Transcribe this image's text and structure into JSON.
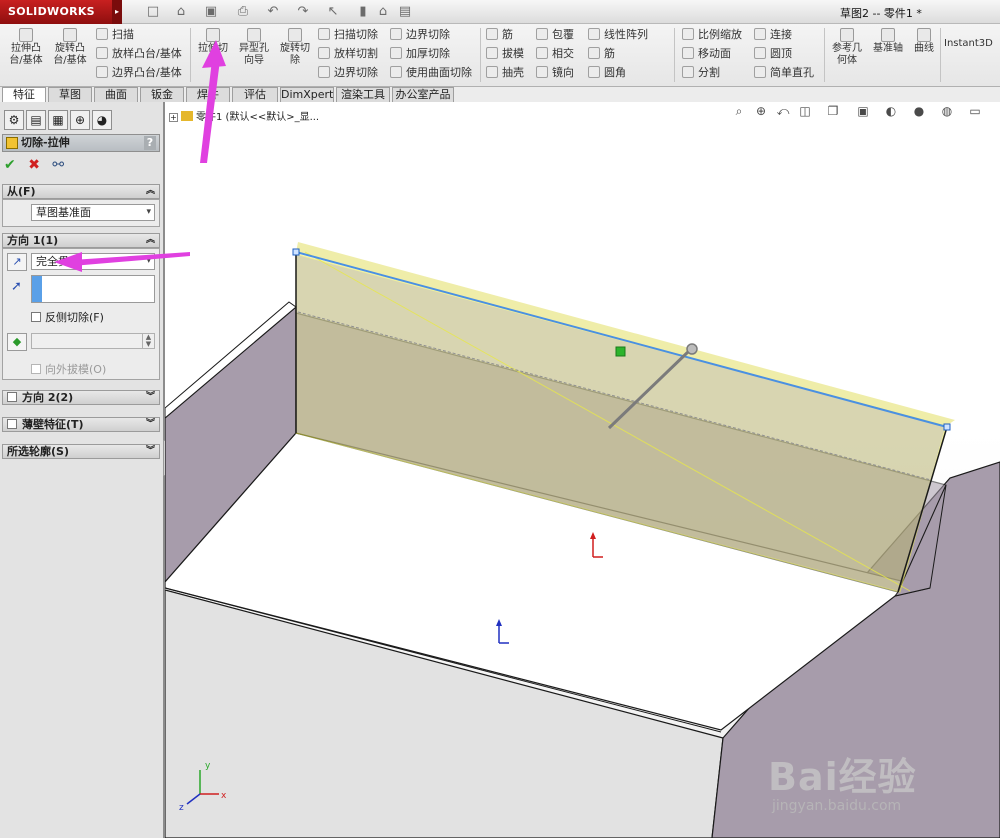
{
  "app": {
    "brand": "SOLIDWORKS",
    "document_title": "草图2 -- 零件1 *"
  },
  "quick_access": [
    "new-icon",
    "open-icon",
    "save-icon",
    "print-icon",
    "undo-icon",
    "redo-icon",
    "select-icon",
    "rebuild-icon",
    "options-icon"
  ],
  "toolbar": {
    "extrude_boss": "拉伸凸\n台/基体",
    "revolve_boss": "旋转凸\n台/基体",
    "sweep": "扫描",
    "loft_boss": "放样凸台/基体",
    "boundary_boss": "边界凸台/基体",
    "extrude_cut": "拉伸切\n除",
    "hole_wizard": "异型孔\n向导",
    "revolve_cut": "旋转切\n除",
    "swept_cut": "扫描切除",
    "lofted_cut": "放样切割",
    "boundary_cut": "边界切除",
    "boundary_cut2": "边界切除",
    "thicken_cut": "加厚切除",
    "surface_cut": "使用曲面切除",
    "rib": "筋",
    "draft": "拔模",
    "shell": "抽壳",
    "wrap": "包覆",
    "intersect": "相交",
    "mirror": "镜向",
    "linear_pattern": "线性阵列",
    "rib2": "筋",
    "fillet": "圆角",
    "scale": "比例缩放",
    "move_face": "移动面",
    "split": "分割",
    "connect": "连接",
    "dome": "圆顶",
    "simple_hole": "简单直孔",
    "ref_geometry": "参考几\n何体",
    "datum_axis": "基准轴",
    "curves": "曲线",
    "instant3d": "Instant3D"
  },
  "tabs": [
    {
      "label": "特征",
      "active": true
    },
    {
      "label": "草图",
      "active": false
    },
    {
      "label": "曲面",
      "active": false
    },
    {
      "label": "钣金",
      "active": false
    },
    {
      "label": "焊件",
      "active": false
    },
    {
      "label": "评估",
      "active": false
    },
    {
      "label": "DimXpert",
      "active": false
    },
    {
      "label": "渲染工具",
      "active": false
    },
    {
      "label": "办公室产品",
      "active": false
    }
  ],
  "property_manager": {
    "title": "切除-拉伸",
    "help": "?",
    "ok_icon": "check-icon",
    "cancel_icon": "close-icon",
    "preview_icon": "glasses-icon",
    "from": {
      "header": "从(F)",
      "value": "草图基准面"
    },
    "direction1": {
      "header": "方向 1(1)",
      "end_condition": "完全贯穿",
      "reverse_cut": "反侧切除(F)",
      "draft_outward": "向外拔模(O)"
    },
    "direction2": {
      "header": "方向 2(2)"
    },
    "thin_feature": {
      "header": "薄壁特征(T)"
    },
    "selected_contours": {
      "header": "所选轮廓(S)"
    }
  },
  "viewport": {
    "tree_label": "零件1  (默认<<默认>_显...",
    "hud_icons": [
      "zoom-fit-icon",
      "zoom-area-icon",
      "previous-view-icon",
      "section-view-icon",
      "view-orientation-icon",
      "display-style-icon",
      "hide-show-icon",
      "edit-appearance-icon",
      "scene-icon",
      "view-settings-icon"
    ],
    "triad_labels": [
      "x",
      "y",
      "z"
    ]
  },
  "watermark": {
    "text": "Bai经验",
    "url_text": "jingyan.baidu.com"
  },
  "colors": {
    "sketch_blue": "#4a90e2",
    "preview_yellow": "#e8e84a",
    "wall_mauve": "#a79cab",
    "annotation_magenta": "#e040e0",
    "brand_red": "#c82020"
  }
}
